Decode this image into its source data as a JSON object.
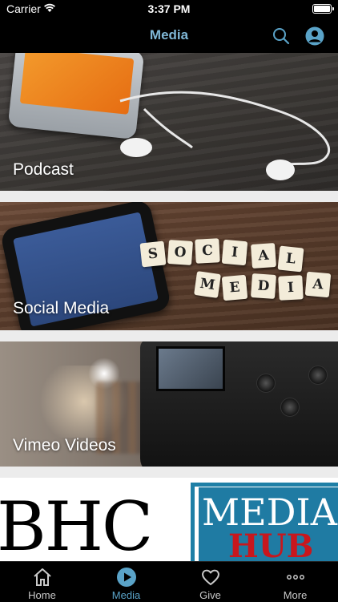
{
  "status_bar": {
    "carrier": "Carrier",
    "time": "3:37 PM"
  },
  "nav": {
    "title": "Media"
  },
  "media_items": [
    {
      "label": "Podcast"
    },
    {
      "label": "Social Media"
    },
    {
      "label": "Vimeo Videos"
    },
    {
      "label": "",
      "banner_left": "BHC",
      "banner_right_top": "MEDIA",
      "banner_right_bottom": "HUB"
    }
  ],
  "social_tiles": {
    "row1": [
      "S",
      "O",
      "C",
      "I",
      "A",
      "L"
    ],
    "row2": [
      "M",
      "E",
      "D",
      "I",
      "A"
    ]
  },
  "tabs": [
    {
      "label": "Home",
      "icon": "home-icon"
    },
    {
      "label": "Media",
      "icon": "play-icon",
      "active": true
    },
    {
      "label": "Give",
      "icon": "heart-icon"
    },
    {
      "label": "More",
      "icon": "more-icon"
    }
  ],
  "colors": {
    "accent": "#5aa3c8",
    "nav_title": "#7fb7d6",
    "brand_blue": "#1f7ba3",
    "brand_red": "#c8171d"
  }
}
